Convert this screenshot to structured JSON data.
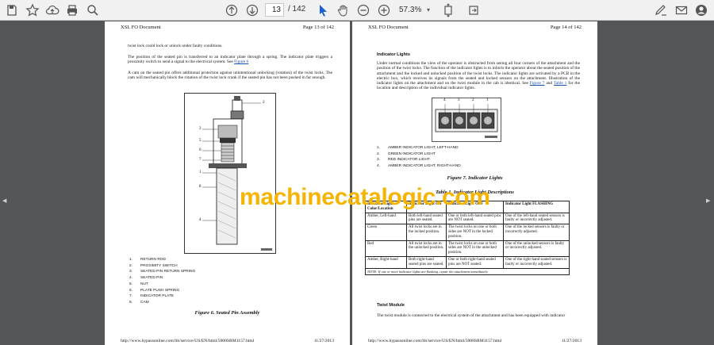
{
  "toolbar": {
    "icons": [
      "save-icon",
      "bookmark-icon",
      "upload-icon",
      "print-icon",
      "search-icon",
      "page-up-icon",
      "page-down-icon",
      "select-cursor-icon",
      "hand-icon",
      "zoom-out-icon",
      "zoom-in-icon",
      "fit-icon",
      "rotate-icon",
      "sign-icon",
      "email-icon",
      "account-icon"
    ],
    "current_page": "13",
    "total_pages": "/ 142",
    "zoom": "57.3%"
  },
  "left_page": {
    "header_title": "XSL FO Document",
    "header_page": "Page 13 of 142",
    "p1": "twist lock could lock or unlock under faulty conditions.",
    "p2": "The position of the seated pin is transferred to an indicator plate through a spring. The indicator plate triggers a proximity switch to send a signal to the electrical system. See",
    "p2_link": "Figure 6",
    "p3": "A cam on the seated pin offers additional protection against unintentional unlocking (rotation) of the twist locks. The cam will mechanically block the rotation of the twist lock crank if the seated pin has not been pushed in far enough.",
    "figure_labels": [
      "1",
      "2",
      "3",
      "4",
      "5",
      "6",
      "7",
      "8"
    ],
    "legend": [
      {
        "num": "1.",
        "text": "RETURN ROD"
      },
      {
        "num": "2.",
        "text": "PROXIMITY SWITCH"
      },
      {
        "num": "3.",
        "text": "SEATED PIN RETURN SPRING"
      },
      {
        "num": "4.",
        "text": "SEATED PIN"
      },
      {
        "num": "5.",
        "text": "NUT"
      },
      {
        "num": "6.",
        "text": "PLATE PUSH SPRING"
      },
      {
        "num": "7.",
        "text": "INDICATOR PLATE"
      },
      {
        "num": "8.",
        "text": "CAM"
      }
    ],
    "caption": "Figure 6. Seated Pin Assembly",
    "footer_url": "http://www.hypassonline.com/lib/service/US/EN/html/5000SRM1157.html",
    "footer_date": "11/27/2013"
  },
  "right_page": {
    "header_title": "XSL FO Document",
    "header_page": "Page 14 of 142",
    "section_title": "Indicator Lights",
    "p1": "Under normal conditions the view of the operator is obstructed from seeing all four corners of the attachment and the position of the twist locks. The function of the indicator lights is to inform the operator about the seated position of the attachment and the locked and unlocked position of the twist locks. The indicator lights are activated by a PCB in the electric box, which receives its signals from the seated and locked sensors on the attachment. Illustration of the indicator lights on the attachment and on the twist module in the cab is identical. See",
    "p1_link1": "Figure 7",
    "p1_and": "and",
    "p1_link2": "Table 1",
    "p1_tail": "for the location and description of the individual indicator lights.",
    "figure_labels": [
      "4",
      "3",
      "2",
      "1"
    ],
    "legend": [
      {
        "num": "1.",
        "text": "AMBER INDICATOR LIGHT, LEFT-HAND"
      },
      {
        "num": "2.",
        "text": "GREEN INDICATOR LIGHT"
      },
      {
        "num": "3.",
        "text": "RED INDICATOR LIGHT"
      },
      {
        "num": "4.",
        "text": "AMBER INDICATOR LIGHT, RIGHT-HAND"
      }
    ],
    "figure_caption": "Figure 7. Indicator Lights",
    "table_caption": "Table 1. Indicator Light Descriptions",
    "table": {
      "headers": [
        "Indicator Light Color/Location",
        "Indicator Light ON",
        "Indicator Light OFF",
        "Indicator Light FLASHING"
      ],
      "rows": [
        [
          "Amber, Left-hand",
          "Both left-hand seated pins are seated.",
          "One or both left-hand seated pins are NOT seated.",
          "One of the left-hand seated sensors is faulty or incorrectly adjusted."
        ],
        [
          "Green",
          "All twist locks are in the locked position.",
          "The twist locks on one or both sides are NOT in the locked position.",
          "One of the locked sensors is faulty or incorrectly adjusted."
        ],
        [
          "Red",
          "All twist locks are in the unlocked position.",
          "The twist locks on one or both sides are NOT in the unlocked position.",
          "One of the unlocked sensors is faulty or incorrectly adjusted."
        ],
        [
          "Amber, Right-hand",
          "Both right-hand seated pins are seated.",
          "One or both right-hand seated pins are NOT seated.",
          "One of the right-hand seated sensors is faulty or incorrectly adjusted."
        ]
      ],
      "note": "NOTE: If one or more indicator lights are flashing, repair the attachment immediately."
    },
    "section2_title": "Twist Module",
    "p2": "The twist module is connected to the electrical system of the attachment and has been equipped with indicator",
    "footer_url": "http://www.hypassonline.com/lib/service/US/EN/html/5000SRM1157.html",
    "footer_date": "11/27/2013"
  },
  "watermark": "machinecatalogic.com",
  "colors": {
    "toolbar": "#f1f1f1",
    "viewer_bg": "#525659",
    "link": "#1a4fb0",
    "watermark": "#f5b400"
  }
}
